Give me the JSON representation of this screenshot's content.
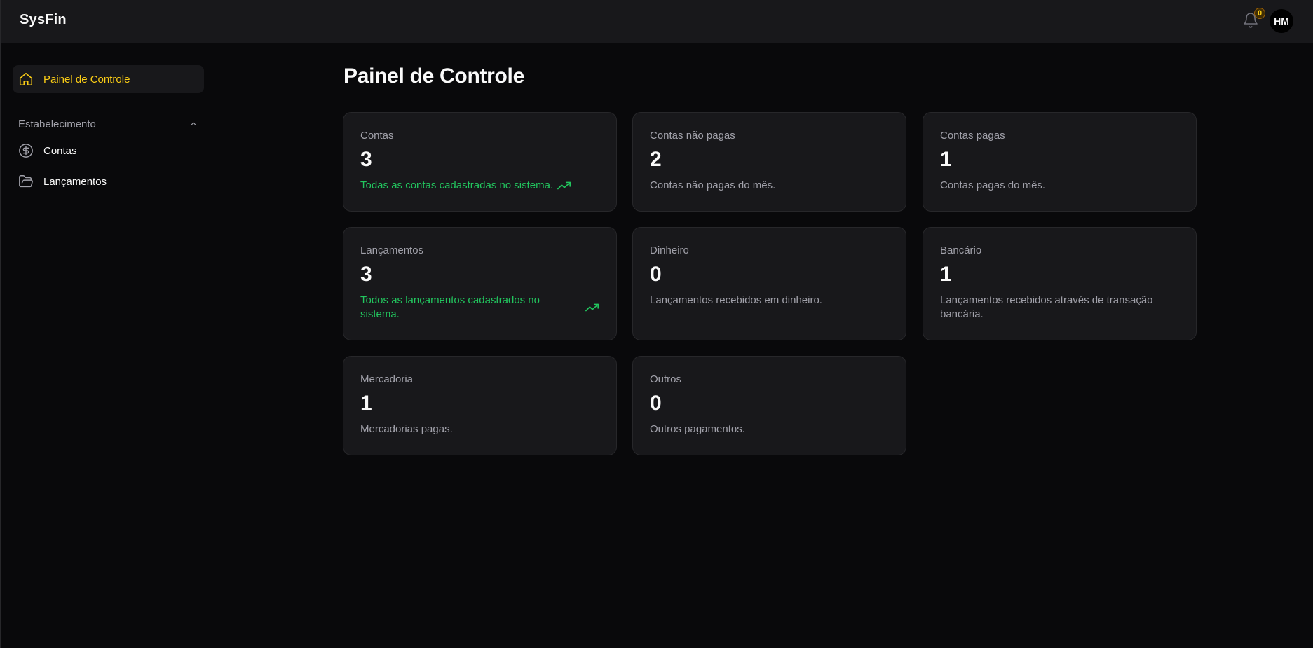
{
  "app": {
    "brand": "SysFin"
  },
  "header": {
    "notifications_count": "0",
    "avatar_initials": "HM"
  },
  "sidebar": {
    "items": [
      {
        "label": "Painel de Controle",
        "icon": "home-icon",
        "active": true
      }
    ],
    "section": {
      "label": "Estabelecimento",
      "expanded": true,
      "items": [
        {
          "label": "Contas",
          "icon": "dollar-circle-icon"
        },
        {
          "label": "Lançamentos",
          "icon": "folder-open-icon"
        }
      ]
    }
  },
  "main": {
    "title": "Painel de Controle",
    "cards": [
      {
        "title": "Contas",
        "value": "3",
        "desc": "Todas as contas cadastradas no sistema.",
        "trend": true
      },
      {
        "title": "Contas não pagas",
        "value": "2",
        "desc": "Contas não pagas do mês."
      },
      {
        "title": "Contas pagas",
        "value": "1",
        "desc": "Contas pagas do mês."
      },
      {
        "title": "Lançamentos",
        "value": "3",
        "desc": "Todos as lançamentos cadastrados no sistema.",
        "trend": true
      },
      {
        "title": "Dinheiro",
        "value": "0",
        "desc": "Lançamentos recebidos em dinheiro."
      },
      {
        "title": "Bancário",
        "value": "1",
        "desc": "Lançamentos recebidos através de transação bancária."
      },
      {
        "title": "Mercadoria",
        "value": "1",
        "desc": "Mercadorias pagas."
      },
      {
        "title": "Outros",
        "value": "0",
        "desc": "Outros pagamentos."
      }
    ]
  },
  "colors": {
    "accent": "#facc15",
    "positive": "#22c55e",
    "card_bg": "#18181b",
    "page_bg": "#09090b"
  }
}
